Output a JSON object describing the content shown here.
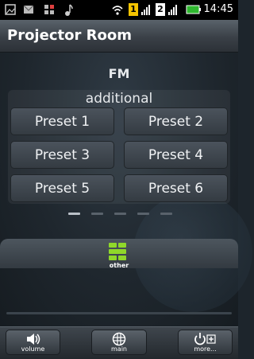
{
  "status_bar": {
    "time": "14:45",
    "icons": [
      "picture-icon",
      "mail-icon",
      "bars-icon",
      "music-icon",
      "wifi-icon",
      "sim1-icon",
      "sim2-icon",
      "battery-icon"
    ],
    "sim1_label": "1",
    "sim2_label": "2"
  },
  "header": {
    "title": "Projector Room"
  },
  "source": {
    "label": "FM"
  },
  "presets": {
    "title": "additional",
    "buttons": [
      "Preset 1",
      "Preset 2",
      "Preset 3",
      "Preset 4",
      "Preset 5",
      "Preset 6"
    ]
  },
  "pager": {
    "page_count": 5,
    "active_index": 0
  },
  "category": {
    "label": "other",
    "icon": "other-grid-icon",
    "accent": "#8fd82a"
  },
  "toolbar": {
    "volume_label": "volume",
    "main_label": "main",
    "more_label": "more..."
  }
}
